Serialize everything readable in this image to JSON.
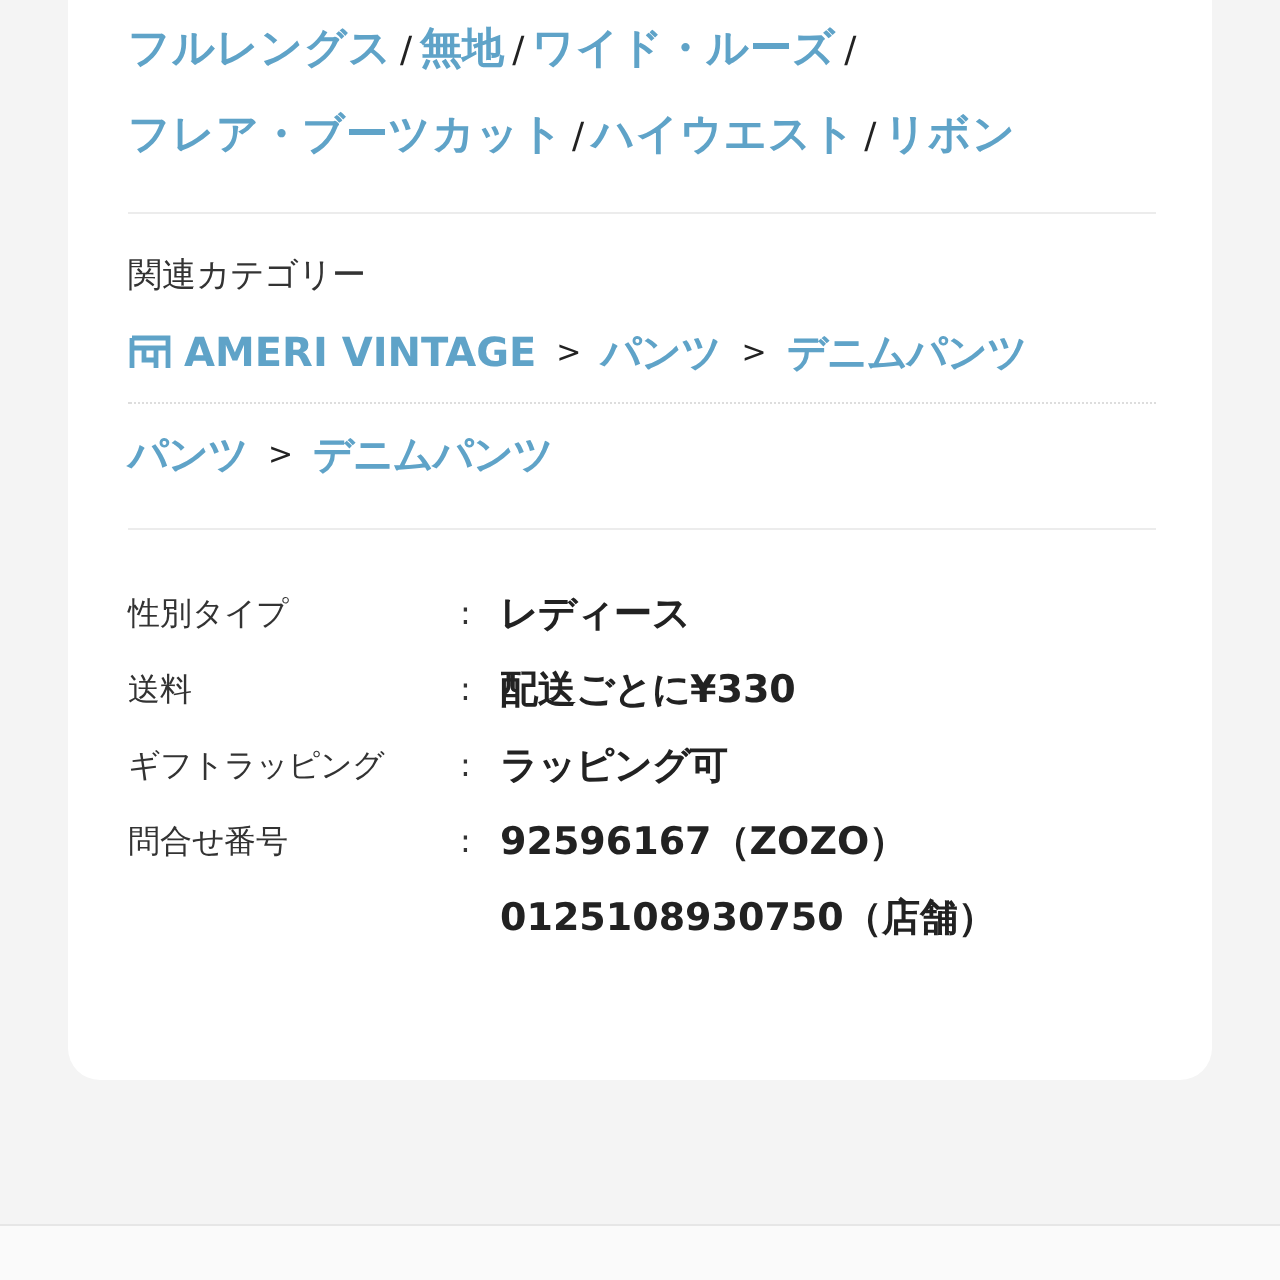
{
  "tags": [
    {
      "label": "フルレングス",
      "sep": "/"
    },
    {
      "label": "無地",
      "sep": "/"
    },
    {
      "label": "ワイド・ルーズ",
      "sep": "/"
    },
    {
      "label": "フレア・ブーツカット",
      "sep": "/"
    },
    {
      "label": "ハイウエスト",
      "sep": "/"
    },
    {
      "label": "リボン"
    }
  ],
  "related": {
    "label": "関連カテゴリー",
    "paths": [
      {
        "shop": true,
        "items": [
          {
            "kind": "link",
            "text": "AMERI VINTAGE"
          },
          {
            "kind": "separator",
            "text": ">"
          },
          {
            "kind": "link",
            "text": "パンツ"
          },
          {
            "kind": "separator",
            "text": ">"
          },
          {
            "kind": "link",
            "text": "デニムパンツ"
          }
        ]
      },
      {
        "shop": false,
        "items": [
          {
            "kind": "link",
            "text": "パンツ"
          },
          {
            "kind": "separator",
            "text": ">"
          },
          {
            "kind": "link",
            "text": "デニムパンツ"
          }
        ]
      }
    ]
  },
  "details": [
    {
      "label": "性別タイプ",
      "colon": ":",
      "values": [
        "レディース"
      ]
    },
    {
      "label": "送料",
      "colon": ":",
      "values": [
        "配送ごとに¥330"
      ]
    },
    {
      "label": "ギフトラッピング",
      "colon": ":",
      "values": [
        "ラッピング可"
      ]
    },
    {
      "label": "問合せ番号",
      "colon": ":",
      "values": [
        "92596167（ZOZO）",
        "0125108930750（店舗）"
      ]
    }
  ]
}
